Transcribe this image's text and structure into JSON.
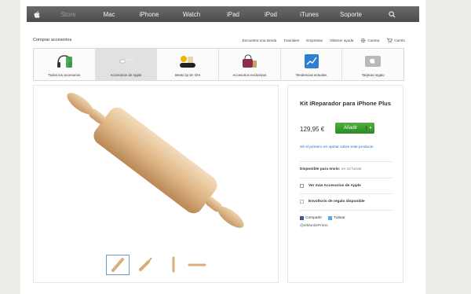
{
  "topnav": {
    "items": [
      "Store",
      "Mac",
      "iPhone",
      "Watch",
      "iPad",
      "iPod",
      "iTunes",
      "Soporte"
    ]
  },
  "subheader": {
    "title": "Comprar accesorios",
    "links": [
      "Encuentra una tienda",
      "Tutoriales",
      "Empresas",
      "Obtener ayuda",
      "Cuenta",
      "Carrito"
    ]
  },
  "categories": [
    {
      "label": "Todos los accesorios",
      "icon": "headphones-icon"
    },
    {
      "label": "Accesorios de Apple",
      "icon": "cable-icon"
    },
    {
      "label": "Beats by Dr. Dre",
      "icon": "beats-speaker-icon"
    },
    {
      "label": "Accesorios exclusivos",
      "icon": "bag-icon"
    },
    {
      "label": "Tendencias actuales",
      "icon": "trend-icon"
    },
    {
      "label": "Tarjetas regalo",
      "icon": "gift-card-icon"
    }
  ],
  "product": {
    "title": "Kit iReparador para iPhone Plus",
    "price": "129,95 €",
    "add_label": "Añadir",
    "notify": "Sé el primero en opinar sobre este producto",
    "shipping_label": "Disponible para envío:",
    "shipping_value": "en 24 horas",
    "more_label": "Ver más Accesorios de Apple",
    "gift_label": "Envoltorio de regalo disponible",
    "share_facebook": "Compartir",
    "share_twitter": "Tuitear",
    "handle": "@elMonitePrieto"
  },
  "thumbnails": [
    "rolling-pin-thumb-1",
    "rolling-pin-thumb-2",
    "rolling-pin-thumb-3",
    "rolling-pin-thumb-4"
  ]
}
